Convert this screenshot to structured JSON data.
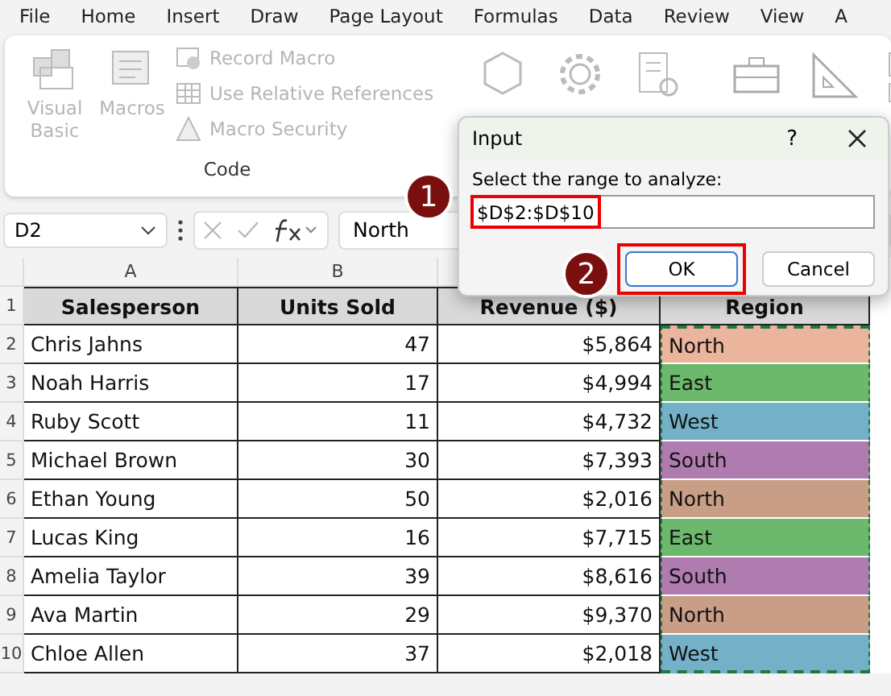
{
  "menu": [
    {
      "label": "File"
    },
    {
      "label": "Home"
    },
    {
      "label": "Insert"
    },
    {
      "label": "Draw"
    },
    {
      "label": "Page Layout"
    },
    {
      "label": "Formulas"
    },
    {
      "label": "Data"
    },
    {
      "label": "Review"
    },
    {
      "label": "View"
    },
    {
      "label": "A"
    }
  ],
  "ribbon": {
    "big_buttons": [
      {
        "label": "Visual Basic",
        "disabled": true
      },
      {
        "label": "Macros",
        "disabled": true
      }
    ],
    "small_buttons": [
      {
        "label": "Record Macro",
        "disabled": true
      },
      {
        "label": "Use Relative References",
        "disabled": true
      },
      {
        "label": "Macro Security",
        "disabled": true
      }
    ],
    "group_label": "Code"
  },
  "formula_bar": {
    "name_box": "D2",
    "value": "North"
  },
  "columns": [
    "A",
    "B"
  ],
  "header_row_number": "1",
  "headers": [
    "Salesperson",
    "Units Sold",
    "Revenue ($)",
    "Region"
  ],
  "rows": [
    {
      "num": "2",
      "name": "Chris Jahns",
      "units": "47",
      "revenue": "$5,864",
      "region": "North",
      "color": "#ebb49c"
    },
    {
      "num": "3",
      "name": "Noah Harris",
      "units": "17",
      "revenue": "$4,994",
      "region": "East",
      "color": "#6cb86c"
    },
    {
      "num": "4",
      "name": "Ruby Scott",
      "units": "11",
      "revenue": "$4,732",
      "region": "West",
      "color": "#74b0c8"
    },
    {
      "num": "5",
      "name": "Michael Brown",
      "units": "30",
      "revenue": "$7,393",
      "region": "South",
      "color": "#b07cb0"
    },
    {
      "num": "6",
      "name": "Ethan Young",
      "units": "50",
      "revenue": "$2,016",
      "region": "North",
      "color": "#c99e86"
    },
    {
      "num": "7",
      "name": "Lucas King",
      "units": "16",
      "revenue": "$7,715",
      "region": "East",
      "color": "#6cb86c"
    },
    {
      "num": "8",
      "name": "Amelia Taylor",
      "units": "39",
      "revenue": "$8,616",
      "region": "South",
      "color": "#b07cb0"
    },
    {
      "num": "9",
      "name": "Ava Martin",
      "units": "29",
      "revenue": "$9,370",
      "region": "North",
      "color": "#c99e86"
    },
    {
      "num": "10",
      "name": "Chloe Allen",
      "units": "37",
      "revenue": "$2,018",
      "region": "West",
      "color": "#74b0c8"
    }
  ],
  "dialog": {
    "title": "Input",
    "help": "?",
    "prompt": "Select the range to analyze:",
    "value": "$D$2:$D$10",
    "buttons": [
      {
        "label": "OK",
        "kind": "default"
      },
      {
        "label": "Cancel",
        "kind": "normal"
      }
    ]
  },
  "callouts": [
    {
      "label": "1"
    },
    {
      "label": "2"
    }
  ]
}
